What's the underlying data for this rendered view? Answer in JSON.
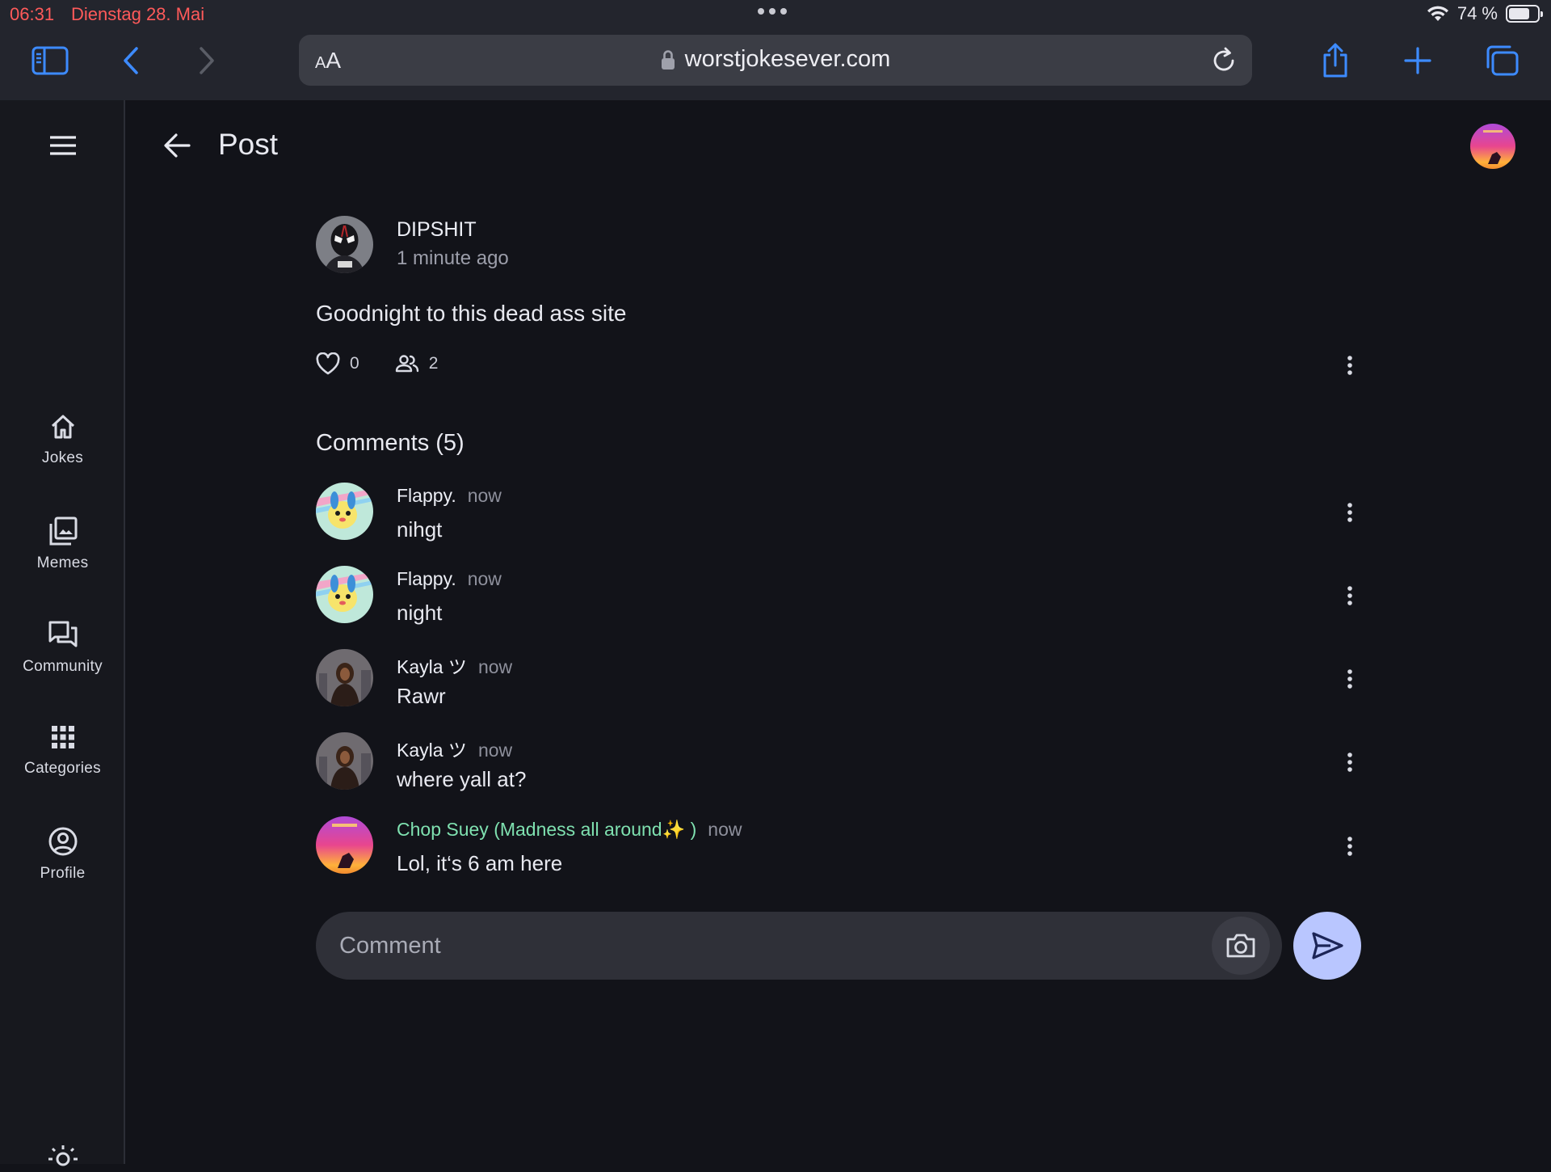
{
  "status_bar": {
    "time": "06:31",
    "date": "Dienstag 28. Mai",
    "battery_text": "74 %",
    "battery_level": 0.74
  },
  "browser": {
    "text_size_label": "AA",
    "url": "worstjokesever.com"
  },
  "sidebar": {
    "items": [
      {
        "label": "Jokes",
        "icon": "home-icon"
      },
      {
        "label": "Memes",
        "icon": "images-icon"
      },
      {
        "label": "Community",
        "icon": "forum-icon"
      },
      {
        "label": "Categories",
        "icon": "grid-icon"
      },
      {
        "label": "Profile",
        "icon": "account-icon"
      }
    ]
  },
  "header": {
    "title": "Post"
  },
  "post": {
    "author": "DIPSHIT",
    "time": "1 minute ago",
    "body": "Goodnight to this dead ass site",
    "likes": "0",
    "participants": "2"
  },
  "comments_section": {
    "heading": "Comments (5)",
    "items": [
      {
        "author": "Flappy.",
        "time": "now",
        "body": "nihgt"
      },
      {
        "author": "Flappy.",
        "time": "now",
        "body": "night"
      },
      {
        "author": "Kayla ツ",
        "time": "now",
        "body": "Rawr"
      },
      {
        "author": "Kayla ツ",
        "time": "now",
        "body": "where yall at?"
      },
      {
        "author": "Chop Suey (Madness all around✨ )",
        "time": "now",
        "body": "Lol, it‘s 6 am here"
      }
    ]
  },
  "comment_input": {
    "placeholder": "Comment"
  },
  "colors": {
    "background": "#121319",
    "accent": "#b9c6ff",
    "highlight_name": "#7fe1b0",
    "status_red": "#ff5a5a"
  }
}
